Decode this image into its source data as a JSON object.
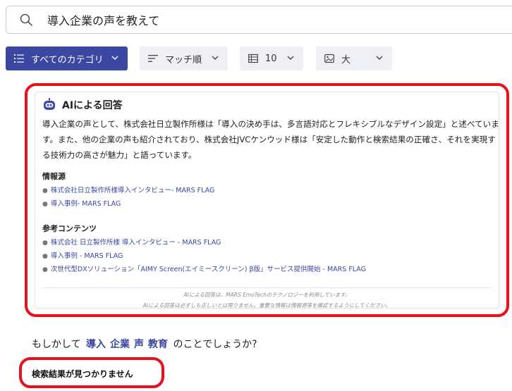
{
  "search": {
    "query": "導入企業の声を教えて",
    "icon": "search-icon"
  },
  "toolbar": {
    "category": "すべてのカテゴリ",
    "sort": "マッチ順",
    "count": "10",
    "size": "大"
  },
  "ai": {
    "title": "AIによる回答",
    "answer": "導入企業の声として、株式会社日立製作所様は「導入の決め手は、多言語対応とフレキシブルなデザイン設定」と述べています。また、他の企業の声も紹介されており、株式会社JVCケンウッド様は「安定した動作と検索結果の正確さ、それを実現する技術力の高さが魅力」と語っています。",
    "sources_title": "情報源",
    "sources": [
      "株式会社日立製作所様導入インタビュー- MARS FLAG",
      "導入事例- MARS FLAG"
    ],
    "refs_title": "参考コンテンツ",
    "refs": [
      "株式会社 日立製作所様 導入インタビュー - MARS FLAG",
      "導入事例 - MARS FLAG",
      "次世代型DXソリューション「AIMY Screen(エイミースクリーン) β版」サービス提供開始 - MARS FLAG"
    ],
    "disclaimer_1": "AIによる回答は、MARS EmoTechのテクノロジーを利用しています。",
    "disclaimer_2": "AIによる回答は必ずしも正しいとは限りません。重要な情報は情報源等を確認するようにしてください。"
  },
  "suggest": {
    "prefix": "もしかして",
    "keywords": [
      "導入",
      "企業",
      "声",
      "教育"
    ],
    "suffix": "のことでしょうか?"
  },
  "no_results": "検索結果が見つかりません",
  "colors": {
    "accent": "#3b47a0",
    "highlight": "#e8101a"
  }
}
